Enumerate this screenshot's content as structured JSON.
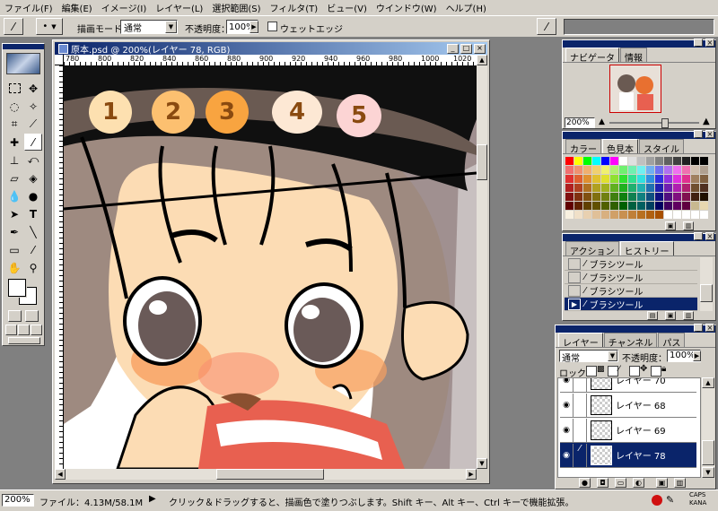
{
  "menu": [
    "ファイル(F)",
    "編集(E)",
    "イメージ(I)",
    "レイヤー(L)",
    "選択範囲(S)",
    "フィルタ(T)",
    "ビュー(V)",
    "ウインドウ(W)",
    "ヘルプ(H)"
  ],
  "options": {
    "mode_label": "描画モード：",
    "mode_value": "通常",
    "opacity_label": "不透明度：",
    "opacity_value": "100%",
    "wet_edge_label": "ウェットエッジ"
  },
  "document": {
    "title": "原本.psd @ 200%(レイヤー 78, RGB)",
    "ruler_ticks": [
      "780",
      "800",
      "820",
      "840",
      "860",
      "880",
      "900",
      "920",
      "940",
      "960",
      "980",
      "1000",
      "1020"
    ],
    "color_markers": [
      {
        "label": "1",
        "color": "#fde0b0"
      },
      {
        "label": "2",
        "color": "#fcc070"
      },
      {
        "label": "3",
        "color": "#f8a440"
      },
      {
        "label": "4",
        "color": "#fde8d4"
      },
      {
        "label": "5",
        "color": "#fcd4d4"
      }
    ]
  },
  "navigator": {
    "tabs": [
      "ナビゲータ",
      "情報"
    ],
    "zoom": "200%"
  },
  "swatches_panel": {
    "tabs": [
      "カラー",
      "色見本",
      "スタイル"
    ]
  },
  "history": {
    "tabs": [
      "アクション",
      "ヒストリー"
    ],
    "items": [
      "ブラシツール",
      "ブラシツール",
      "ブラシツール",
      "ブラシツール"
    ]
  },
  "layers": {
    "tabs": [
      "レイヤー",
      "チャンネル",
      "パス"
    ],
    "mode": "通常",
    "opacity_label": "不透明度：",
    "opacity": "100%",
    "lock_label": "ロック：",
    "items": [
      "レイヤー 70",
      "レイヤー 68",
      "レイヤー 69",
      "レイヤー 78"
    ]
  },
  "status": {
    "zoom": "200%",
    "file_info": "ファイル：4.13M/58.1M",
    "hint": "クリック＆ドラッグすると、描画色で塗りつぶします。Shift キー、Alt キー、Ctrl キーで機能拡張。",
    "caps": "CAPS",
    "kana": "KANA"
  },
  "colors": {
    "accent": "#0a246a",
    "chrome": "#d4d0c8",
    "workspace": "#808080"
  }
}
